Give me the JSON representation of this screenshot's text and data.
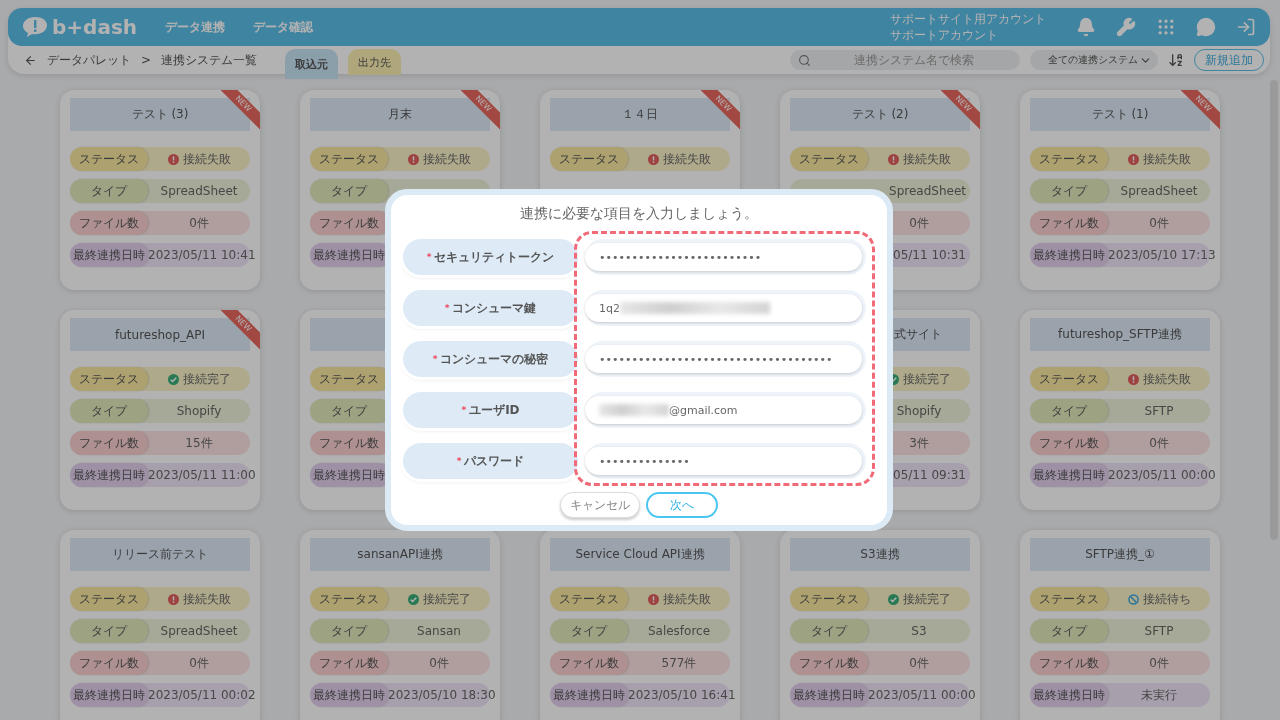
{
  "header": {
    "logo": "b+dash",
    "nav": [
      "データ連携",
      "データ確認"
    ],
    "account": [
      "サポートサイト用アカウント",
      "サポートアカウント"
    ]
  },
  "toolbar": {
    "breadcrumb": [
      "データパレット",
      ">",
      "連携システム一覧"
    ],
    "tabs": [
      {
        "label": "取込元",
        "selected": true
      },
      {
        "label": "出力先",
        "selected": false
      }
    ],
    "search": {
      "placeholder": "連携システム名で検索"
    },
    "filter": "全ての連携システム",
    "add_button": "新規追加"
  },
  "card_rows": [
    {
      "cards": [
        {
          "title": "テスト (3)",
          "badge": "NEW",
          "rows": [
            {
              "label": "ステータス",
              "value": "接続失敗",
              "kind": "failed"
            },
            {
              "label": "タイプ",
              "value": "SpreadSheet"
            },
            {
              "label": "ファイル数",
              "value": "0件"
            },
            {
              "label": "最終連携日時",
              "value": "2023/05/11 10:41"
            }
          ]
        },
        {
          "title": "月末",
          "badge": "NEW",
          "rows": [
            {
              "label": "ステータス",
              "value": "接続失敗",
              "kind": "failed"
            },
            {
              "label": "タイプ"
            },
            {
              "label": "ファイル数"
            },
            {
              "label": "最終連携日時"
            }
          ]
        },
        {
          "title": "１４日",
          "badge": "NEW",
          "rows": [
            {
              "label": "ステータス",
              "value": "接続失敗",
              "kind": "failed"
            }
          ]
        },
        {
          "title": "テスト (2)",
          "badge": "NEW",
          "rows": [
            {
              "label": "ステータス",
              "value": "接続失敗",
              "kind": "failed"
            },
            {
              "value": "SpreadSheet",
              "cut": true
            },
            {
              "value": "0件"
            },
            {
              "value": "05/11 10:31",
              "cut": true
            }
          ]
        },
        {
          "title": "テスト (1)",
          "badge": "NEW",
          "rows": [
            {
              "label": "ステータス",
              "value": "接続失敗",
              "kind": "failed"
            },
            {
              "label": "タイプ",
              "value": "SpreadSheet"
            },
            {
              "label": "ファイル数",
              "value": "0件"
            },
            {
              "label": "最終連携日時",
              "value": "2023/05/10 17:13"
            }
          ]
        }
      ]
    },
    {
      "cards": [
        {
          "title": "futureshop_API",
          "badge": "NEW",
          "rows": [
            {
              "label": "ステータス",
              "value": "接続完了",
              "kind": "done"
            },
            {
              "label": "タイプ",
              "value": "Shopify"
            },
            {
              "label": "ファイル数",
              "value": "15件"
            },
            {
              "label": "最終連携日時",
              "value": "2023/05/11 11:00"
            }
          ]
        },
        {
          "rows": [
            {
              "label": "ステータス"
            },
            {
              "label": "タイプ"
            },
            {
              "label": "ファイル数"
            },
            {
              "label": "最終連携日時"
            }
          ]
        }
      ],
      "cards_right": [
        {
          "title": "式サイト",
          "title_cut": true,
          "rows": [
            {
              "value": "接続完了",
              "kind": "done"
            },
            {
              "value": "Shopify"
            },
            {
              "value": "3件"
            },
            {
              "value": "05/11 09:31",
              "cut": true
            }
          ]
        },
        {
          "title": "futureshop_SFTP連携",
          "rows": [
            {
              "label": "ステータス",
              "value": "接続失敗",
              "kind": "failed"
            },
            {
              "label": "タイプ",
              "value": "SFTP"
            },
            {
              "label": "ファイル数",
              "value": "0件"
            },
            {
              "label": "最終連携日時",
              "value": "2023/05/11 00:00"
            }
          ]
        }
      ]
    },
    {
      "cards": [
        {
          "title": "リリース前テスト",
          "rows": [
            {
              "label": "ステータス",
              "value": "接続失敗",
              "kind": "failed"
            },
            {
              "label": "タイプ",
              "value": "SpreadSheet"
            },
            {
              "label": "ファイル数",
              "value": "0件"
            },
            {
              "label": "最終連携日時",
              "value": "2023/05/11 00:02"
            }
          ]
        },
        {
          "title": "sansanAPI連携",
          "rows": [
            {
              "label": "ステータス",
              "value": "接続完了",
              "kind": "done"
            },
            {
              "label": "タイプ",
              "value": "Sansan"
            },
            {
              "label": "ファイル数",
              "value": "0件"
            },
            {
              "label": "最終連携日時",
              "value": "2023/05/10 18:30"
            }
          ]
        },
        {
          "title": "Service Cloud API連携",
          "rows": [
            {
              "label": "ステータス",
              "value": "接続失敗",
              "kind": "failed"
            },
            {
              "label": "タイプ",
              "value": "Salesforce"
            },
            {
              "label": "ファイル数",
              "value": "577件"
            },
            {
              "label": "最終連携日時",
              "value": "2023/05/10 16:41"
            }
          ]
        },
        {
          "title": "S3連携",
          "rows": [
            {
              "label": "ステータス",
              "value": "接続完了",
              "kind": "done"
            },
            {
              "label": "タイプ",
              "value": "S3"
            },
            {
              "label": "ファイル数",
              "value": "0件"
            },
            {
              "label": "最終連携日時",
              "value": "2023/05/11 00:00"
            }
          ]
        },
        {
          "title": "SFTP連携_①",
          "rows": [
            {
              "label": "ステータス",
              "value": "接続待ち",
              "kind": "waiting"
            },
            {
              "label": "タイプ",
              "value": "SFTP"
            },
            {
              "label": "ファイル数",
              "value": "0件"
            },
            {
              "label": "最終連携日時",
              "value": "未実行"
            }
          ]
        }
      ]
    }
  ],
  "modal": {
    "title": "連携に必要な項目を入力しましょう。",
    "highlight": true,
    "fields": [
      {
        "label": "セキュリティトークン",
        "required": true,
        "value": "•••••••••••••••••••••••••"
      },
      {
        "label": "コンシューマ鍵",
        "required": true,
        "value": "1q2",
        "kind": "blurred_tail"
      },
      {
        "label": "コンシューマの秘密",
        "required": true,
        "value": "••••••••••••••••••••••••••••••••••••"
      },
      {
        "label": "ユーザID",
        "required": true,
        "value": "@gmail.com",
        "kind": "blurred_head"
      },
      {
        "label": "パスワード",
        "required": true,
        "value": "••••••••••••••"
      }
    ],
    "required_mark": "*",
    "buttons": [
      {
        "label": "キャンセル",
        "kind": "secondary"
      },
      {
        "label": "次へ",
        "kind": "primary"
      }
    ]
  }
}
